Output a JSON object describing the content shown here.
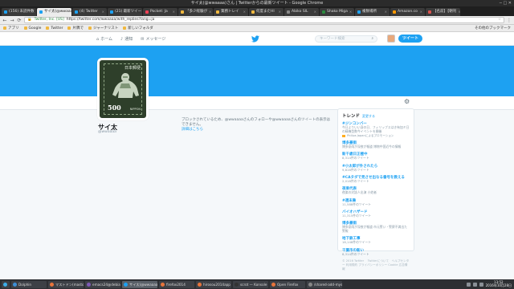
{
  "window": {
    "title": "サイ太(@wwaaaa)さん | Twitterからの最新ツイート - Google Chrome"
  },
  "tabs": [
    {
      "label": "(156) 未読件数",
      "active": false,
      "color": "#1da1f2"
    },
    {
      "label": "サイ太(@wwaaaa)",
      "active": true,
      "color": "#1da1f2"
    },
    {
      "label": "(4) Twitter",
      "active": false,
      "color": "#1da1f2"
    },
    {
      "label": "(21) 最新ツイート",
      "active": false,
      "color": "#1da1f2"
    },
    {
      "label": "Pocket: Ja",
      "active": false,
      "color": "#ef4056"
    },
    {
      "label": "「多少経験が",
      "active": false,
      "color": "#f0b840"
    },
    {
      "label": "業務トレイ",
      "active": false,
      "color": "#f0b840"
    },
    {
      "label": "何度またHI",
      "active": false,
      "color": "#f0b840"
    },
    {
      "label": "Abiko SIL",
      "active": false,
      "color": "#888888"
    },
    {
      "label": "Shako Miga",
      "active": false,
      "color": "#2b8a3e"
    },
    {
      "label": "複数場所",
      "active": false,
      "color": "#1da1f2"
    },
    {
      "label": "Amazon.co",
      "active": false,
      "color": "#ff9900"
    },
    {
      "label": "【名前】【朝刊",
      "active": false,
      "color": "#d9534f"
    }
  ],
  "address": {
    "secure": "Twitter, Inc. [US]",
    "url": "https://twitter.com/wwaaaa/with_replies?lang=ja"
  },
  "bookmarks": {
    "items": [
      "アプリ",
      "Google",
      "Twitter",
      "片隅で",
      "ジャーナリスト",
      "新しいフォルダ"
    ],
    "other": "その他のブックマーク"
  },
  "twitter_nav": {
    "home": "ホーム",
    "notifications": "通知",
    "messages": "メッセージ",
    "search_placeholder": "キーワード検索",
    "tweet_button": "ツイート",
    "brand_color": "#1da1f2"
  },
  "profile": {
    "name": "サイ太",
    "handle": "@wwaaaa",
    "avatar_top_text": "日本郵便",
    "avatar_value": "500",
    "avatar_country": "NIPPON",
    "blocked_message": "ブロックされているため、@wwaaaaさんのフォローや@wwaaaaさんのツイートの表示はできません。",
    "blocked_link": "詳細はこちら"
  },
  "trends": {
    "title": "トレンド",
    "change": "変更する",
    "items": [
      {
        "name": "#ジンコンバー",
        "desc": "今日よりいい身の日、フィリップスはき有加ミ日の精機型数今イベントを開催",
        "promoted": "Philips Japanによるプロモーション"
      },
      {
        "name": "博多豪雨",
        "desc": "博多豪雨が深夜が報道 博物中国近今の情報"
      },
      {
        "name": "新千歳日正極中",
        "desc": "8,314件のツイート"
      },
      {
        "name": "#小太郎が外されたら",
        "desc": "9,816件のツイート"
      },
      {
        "name": "#CAタダで見させ出なる番号を教える",
        "desc": "2,018件のツイート"
      },
      {
        "name": "夜楽代表",
        "desc": "夜楽の対誌人出演 小姓者"
      },
      {
        "name": "#週末乗",
        "desc": "11,588件のツイート"
      },
      {
        "name": "バイオハザード",
        "desc": "11,315件のツイート"
      },
      {
        "name": "博多豪雨",
        "desc": "博多豪雨が深夜が報道 市元警い・警察不満出た警報"
      },
      {
        "name": "地下鉄工事",
        "desc": "16,148件のツイート"
      },
      {
        "name": "千葉市の新い",
        "desc": "8,314件のツイート"
      }
    ],
    "footer": "© 2016 Twitter 　Twitterについて　ヘルプセンター 利用規約 プライバシーポリシー Cookie 広告情報"
  },
  "taskbar": {
    "items": [
      {
        "label": "Dolphin",
        "active": false,
        "color": "#3d8fd6"
      },
      {
        "label": "マストドン(mastodo",
        "active": false,
        "color": "#e8743b"
      },
      {
        "label": "emacs24@debian",
        "active": false,
        "color": "#7f5ab6"
      },
      {
        "label": "サイ太(@wwaaaa",
        "active": true,
        "color": "#1da1f2"
      },
      {
        "label": "firefox2014",
        "active": false,
        "color": "#e8743b"
      },
      {
        "label": "hirosou2014app",
        "active": false,
        "color": "#e8743b"
      },
      {
        "label": "scrot — Konsole",
        "active": false,
        "color": "#333333"
      },
      {
        "label": "Open Firefox",
        "active": false,
        "color": "#e8743b"
      },
      {
        "label": "/shared-add-mysc",
        "active": false,
        "color": "#888888"
      }
    ],
    "time": "13:52",
    "date": "2016年10月28日"
  }
}
